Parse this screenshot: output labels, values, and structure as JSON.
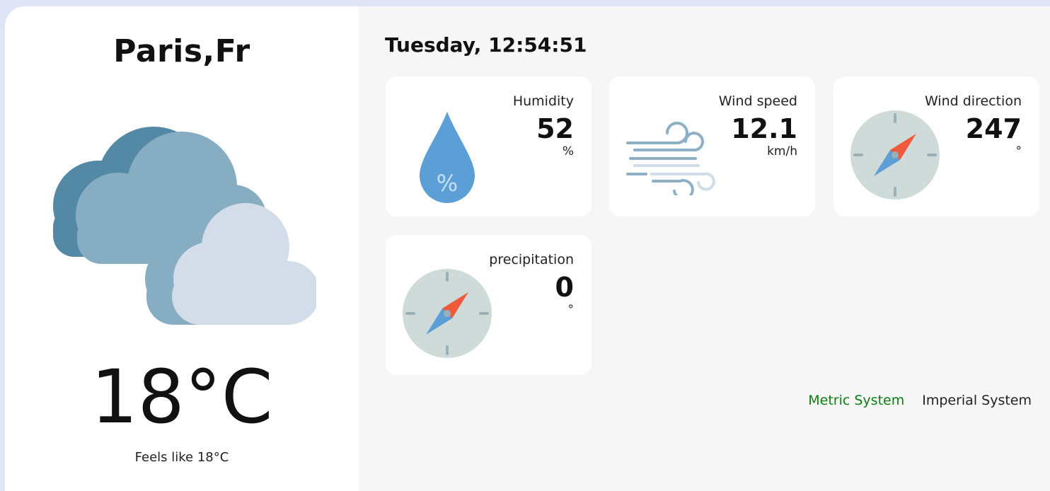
{
  "location": {
    "city": "Paris,Fr"
  },
  "current": {
    "icon": "cloudy-icon",
    "temperature": "18°C",
    "feels_like": "Feels like 18°C"
  },
  "header": {
    "datetime": "Tuesday, 12:54:51"
  },
  "cards": {
    "humidity": {
      "label": "Humidity",
      "value": "52",
      "unit": "%",
      "icon": "humidity-drop-icon"
    },
    "wind_speed": {
      "label": "Wind speed",
      "value": "12.1",
      "unit": "km/h",
      "icon": "wind-icon"
    },
    "wind_direction": {
      "label": "Wind direction",
      "value": "247",
      "unit": "°",
      "icon": "compass-icon"
    },
    "precipitation": {
      "label": "precipitation",
      "value": "0",
      "unit": "°",
      "icon": "compass-icon"
    }
  },
  "unit_toggle": {
    "metric": "Metric System",
    "imperial": "Imperial System",
    "active": "metric"
  },
  "colors": {
    "active_unit": "#0b7d12",
    "drop": "#5b9fd6",
    "compass_face": "#cfdbd9",
    "needle_red": "#ef5a3c",
    "needle_blue": "#5b9fd6"
  }
}
